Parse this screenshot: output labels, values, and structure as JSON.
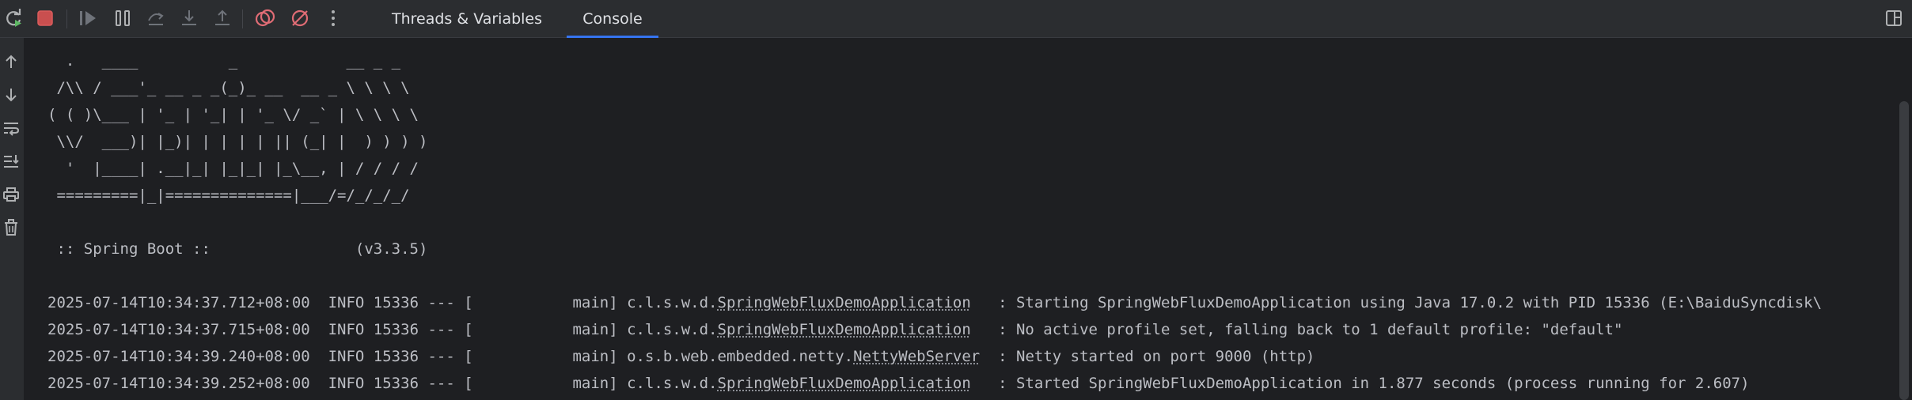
{
  "toolbar": {
    "icons": [
      "rerun-icon",
      "stop-icon",
      "resume-icon",
      "pause-icon",
      "step-over-icon",
      "step-into-icon",
      "step-out-icon",
      "view-breakpoints-icon",
      "mute-breakpoints-icon",
      "more-options-icon"
    ],
    "tabs": [
      {
        "label": "Threads & Variables",
        "active": false
      },
      {
        "label": "Console",
        "active": true
      }
    ],
    "layout_icon": "layout-icon"
  },
  "sidebar": {
    "icons": [
      "scroll-up-icon",
      "scroll-down-icon",
      "soft-wrap-icon",
      "scroll-to-end-icon",
      "print-icon",
      "clear-icon"
    ]
  },
  "console": {
    "banner": [
      "  .   ____          _            __ _ _",
      " /\\\\ / ___'_ __ _ _(_)_ __  __ _ \\ \\ \\ \\",
      "( ( )\\___ | '_ | '_| | '_ \\/ _` | \\ \\ \\ \\",
      " \\\\/  ___)| |_)| | | | | || (_| |  ) ) ) )",
      "  '  |____| .__|_| |_|_| |_\\__, | / / / /",
      " =========|_|==============|___/=/_/_/_/"
    ],
    "spring_boot_line": " :: Spring Boot ::                (v3.3.5)",
    "log_lines": [
      {
        "timestamp": "2025-07-14T10:34:37.712+08:00",
        "meta": "  INFO 15336 --- [           main] ",
        "logger_prefix": "c.l.s.w.d.",
        "logger_class": "SpringWebFluxDemoApplication",
        "message": "   : Starting SpringWebFluxDemoApplication using Java 17.0.2 with PID 15336 (E:\\BaiduSyncdisk\\"
      },
      {
        "timestamp": "2025-07-14T10:34:37.715+08:00",
        "meta": "  INFO 15336 --- [           main] ",
        "logger_prefix": "c.l.s.w.d.",
        "logger_class": "SpringWebFluxDemoApplication",
        "message": "   : No active profile set, falling back to 1 default profile: \"default\""
      },
      {
        "timestamp": "2025-07-14T10:34:39.240+08:00",
        "meta": "  INFO 15336 --- [           main] ",
        "logger_prefix": "o.s.b.web.embedded.netty.",
        "logger_class": "NettyWebServer",
        "message": "  : Netty started on port 9000 (http)"
      },
      {
        "timestamp": "2025-07-14T10:34:39.252+08:00",
        "meta": "  INFO 15336 --- [           main] ",
        "logger_prefix": "c.l.s.w.d.",
        "logger_class": "SpringWebFluxDemoApplication",
        "message": "   : Started SpringWebFluxDemoApplication in 1.877 seconds (process running for 2.607)"
      }
    ]
  },
  "colors": {
    "background": "#1e1f22",
    "toolbar_bg": "#2b2d30",
    "text": "#bcbec4",
    "stop_red": "#db5c5c",
    "breakpoint_red": "#e06c75",
    "tab_underline": "#3574f0"
  }
}
